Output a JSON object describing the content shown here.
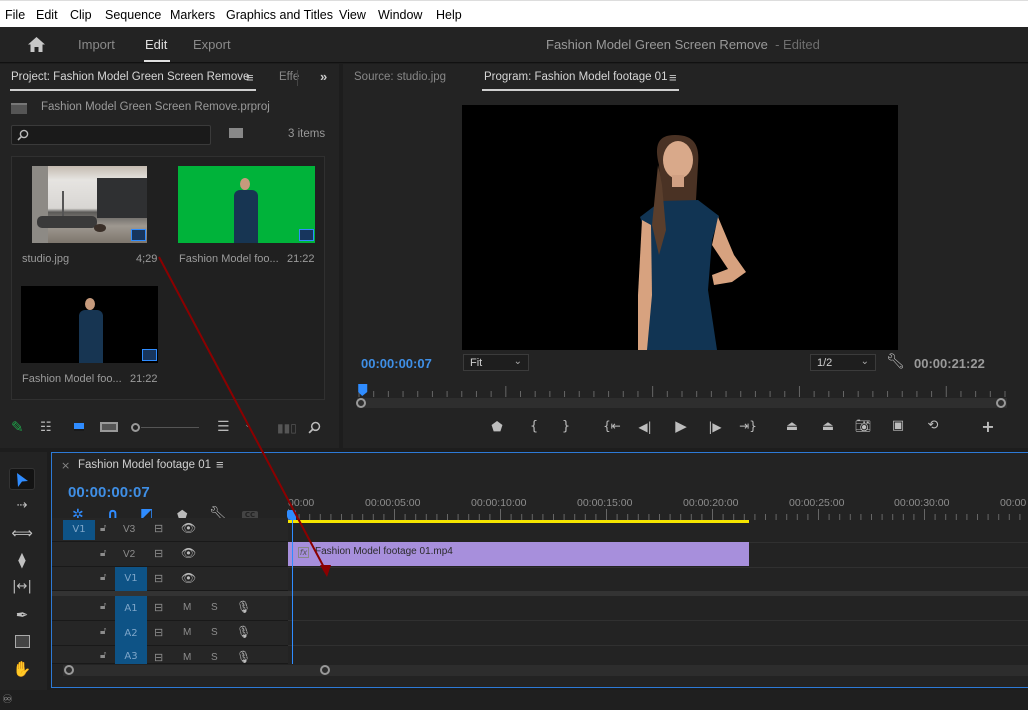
{
  "menubar": {
    "items": [
      "File",
      "Edit",
      "Clip",
      "Sequence",
      "Markers",
      "Graphics and Titles",
      "View",
      "Window",
      "Help"
    ]
  },
  "header": {
    "home_icon": "home-icon",
    "tabs": [
      {
        "label": "Import",
        "active": false
      },
      {
        "label": "Edit",
        "active": true
      },
      {
        "label": "Export",
        "active": false
      }
    ],
    "document_title": "Fashion Model Green Screen Remove",
    "document_status": "- Edited"
  },
  "project_panel": {
    "tab_label": "Project: Fashion Model Green Screen Remove",
    "tab_menu_icon": "hamburger-icon",
    "second_tab_label": "Effe",
    "overflow_icon": "double-chevron-right-icon",
    "project_file": "Fashion Model Green Screen Remove.prproj",
    "search": {
      "value": "",
      "placeholder": ""
    },
    "items_count": "3 items",
    "items": [
      {
        "name": "studio.jpg",
        "duration": "4;29",
        "thumb": "studio",
        "badge": "film-strip-icon"
      },
      {
        "name": "Fashion Model foo...",
        "duration": "21:22",
        "thumb": "green",
        "badge": "film-strip-icon"
      },
      {
        "name": "Fashion Model foo...",
        "duration": "21:22",
        "thumb": "black",
        "badge": "sequence-icon"
      }
    ],
    "footer_icons": [
      "pencil-icon",
      "list-view-icon",
      "icon-view-icon",
      "freeform-view-icon",
      "zoom-slider",
      "sort-icon",
      "automate-icon",
      "find-icon"
    ]
  },
  "monitor": {
    "source_tab": "Source: studio.jpg",
    "program_tab": "Program: Fashion Model footage 01",
    "current_timecode": "00:00:00:07",
    "zoom_fit": "Fit",
    "resolution": "1/2",
    "duration_timecode": "00:00:21:22",
    "playhead_fraction": 0.005,
    "controls": [
      "add-marker",
      "mark-in",
      "mark-out",
      "go-to-in",
      "step-back",
      "play",
      "step-forward",
      "go-to-out",
      "lift",
      "extract",
      "export-frame",
      "insert",
      "overwrite",
      "button-editor"
    ]
  },
  "timeline": {
    "sequence_tab": "Fashion Model footage 01",
    "timecode": "00:00:00:07",
    "ruler_labels": [
      "00:00",
      "00:00:05:00",
      "00:00:10:00",
      "00:00:15:00",
      "00:00:20:00",
      "00:00:25:00",
      "00:00:30:00",
      "00:00"
    ],
    "video_tracks": [
      {
        "source": "V1",
        "name": "V3",
        "targeted": false
      },
      {
        "source": "",
        "name": "V2",
        "targeted": false
      },
      {
        "source": "",
        "name": "V1",
        "targeted": true
      }
    ],
    "audio_tracks": [
      {
        "name": "A1",
        "mute": "M",
        "solo": "S"
      },
      {
        "name": "A2",
        "mute": "M",
        "solo": "S"
      },
      {
        "name": "A3",
        "mute": "M",
        "solo": "S"
      }
    ],
    "clip": {
      "label": "Fashion Model footage 01.mp4",
      "track": "V2",
      "fx": "fx",
      "color": "#a78fdc"
    },
    "work_area_color": "#f5e500"
  },
  "tools": [
    "selection-tool",
    "track-select-tool",
    "ripple-edit-tool",
    "razor-tool",
    "slip-tool",
    "pen-tool",
    "rectangle-tool",
    "hand-tool"
  ],
  "status_bar": {
    "icon": "creative-cloud-icon"
  },
  "annotation": {
    "type": "drag-arrow",
    "color": "#8b0000",
    "from": "studio.jpg",
    "to": "V1 track"
  }
}
